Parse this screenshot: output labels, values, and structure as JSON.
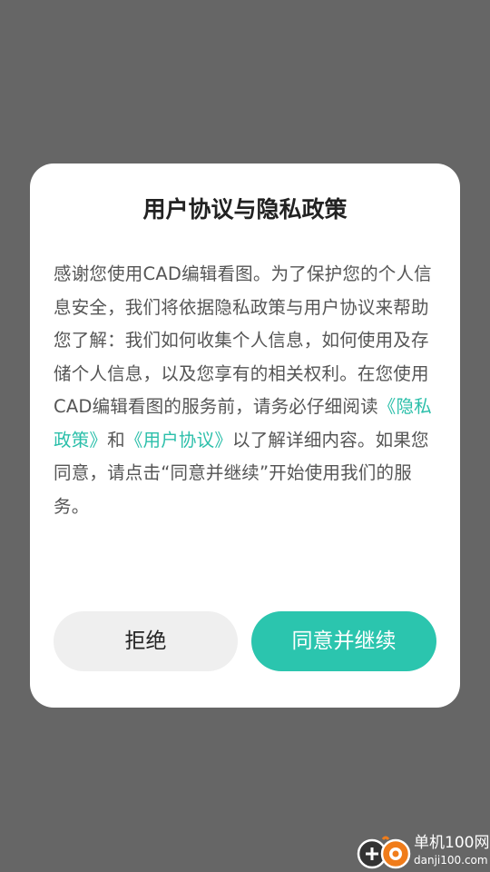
{
  "dialog": {
    "title": "用户协议与隐私政策",
    "body": {
      "p1": "感谢您使用CAD编辑看图。为了保护您的个人信息安全，我们将依据隐私政策与用户协议来帮助您了解：我们如何收集个人信息，如何使用及存储个人信息，以及您享有的相关权利。在您使用CAD编辑看图的服务前，请务必仔细阅读",
      "privacy_link": "《隐私政策》",
      "and": "和",
      "agreement_link": "《用户协议》",
      "p2": "以了解详细内容。如果您同意，请点击“同意并继续”开始使用我们的服务。"
    },
    "decline_label": "拒绝",
    "accept_label": "同意并继续"
  },
  "watermark": {
    "name": "单机100网",
    "url": "danji100.com",
    "logo_icon": "gamepad-logo-icon"
  },
  "colors": {
    "overlay": "#666666",
    "accent": "#2bc5ae",
    "link": "#2bbfaa",
    "decline_bg": "#efefef"
  }
}
